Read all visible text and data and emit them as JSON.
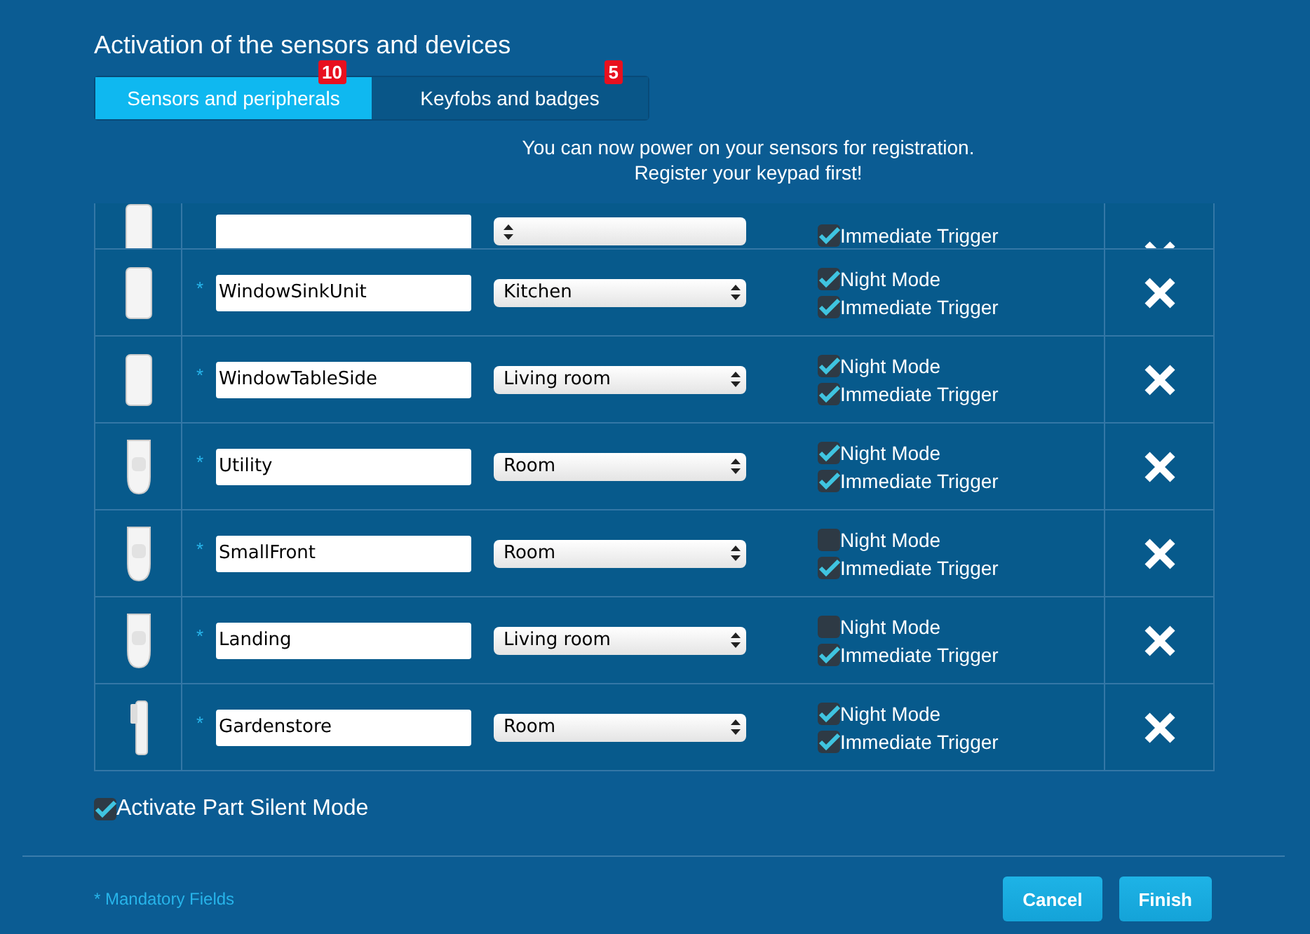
{
  "title": "Activation of the sensors and devices",
  "tabs": [
    {
      "label": "Sensors and peripherals",
      "badge": "10",
      "selected": true
    },
    {
      "label": "Keyfobs and badges",
      "badge": "5",
      "selected": false
    }
  ],
  "message": [
    "You can now power on your sensors for registration.",
    "Register your keypad first!"
  ],
  "scrolled_row": {
    "kind": "contact",
    "options": [
      {
        "label": "Immediate Trigger",
        "checked": true
      }
    ]
  },
  "devices": [
    {
      "kind": "contact",
      "required_mark": "*",
      "name": "WindowSinkUnit",
      "room": "Kitchen",
      "options": [
        {
          "label": "Night Mode",
          "checked": true
        },
        {
          "label": "Immediate Trigger",
          "checked": true
        }
      ]
    },
    {
      "kind": "contact",
      "required_mark": "*",
      "name": "WindowTableSide",
      "room": "Living room",
      "options": [
        {
          "label": "Night Mode",
          "checked": true
        },
        {
          "label": "Immediate Trigger",
          "checked": true
        }
      ]
    },
    {
      "kind": "motion",
      "required_mark": "*",
      "name": "Utility",
      "room": "Room",
      "options": [
        {
          "label": "Night Mode",
          "checked": true
        },
        {
          "label": "Immediate Trigger",
          "checked": true
        }
      ]
    },
    {
      "kind": "motion",
      "required_mark": "*",
      "name": "SmallFront",
      "room": "Room",
      "options": [
        {
          "label": "Night Mode",
          "checked": false
        },
        {
          "label": "Immediate Trigger",
          "checked": true
        }
      ]
    },
    {
      "kind": "motion",
      "required_mark": "*",
      "name": "Landing",
      "room": "Living room",
      "options": [
        {
          "label": "Night Mode",
          "checked": false
        },
        {
          "label": "Immediate Trigger",
          "checked": true
        }
      ]
    },
    {
      "kind": "slim",
      "required_mark": "*",
      "name": "Gardenstore",
      "room": "Room",
      "options": [
        {
          "label": "Night Mode",
          "checked": true
        },
        {
          "label": "Immediate Trigger",
          "checked": true
        }
      ]
    }
  ],
  "part_silent": {
    "label": "Activate Part Silent Mode",
    "checked": true
  },
  "footer_note": "* Mandatory Fields",
  "buttons": [
    "Cancel",
    "Finish"
  ]
}
